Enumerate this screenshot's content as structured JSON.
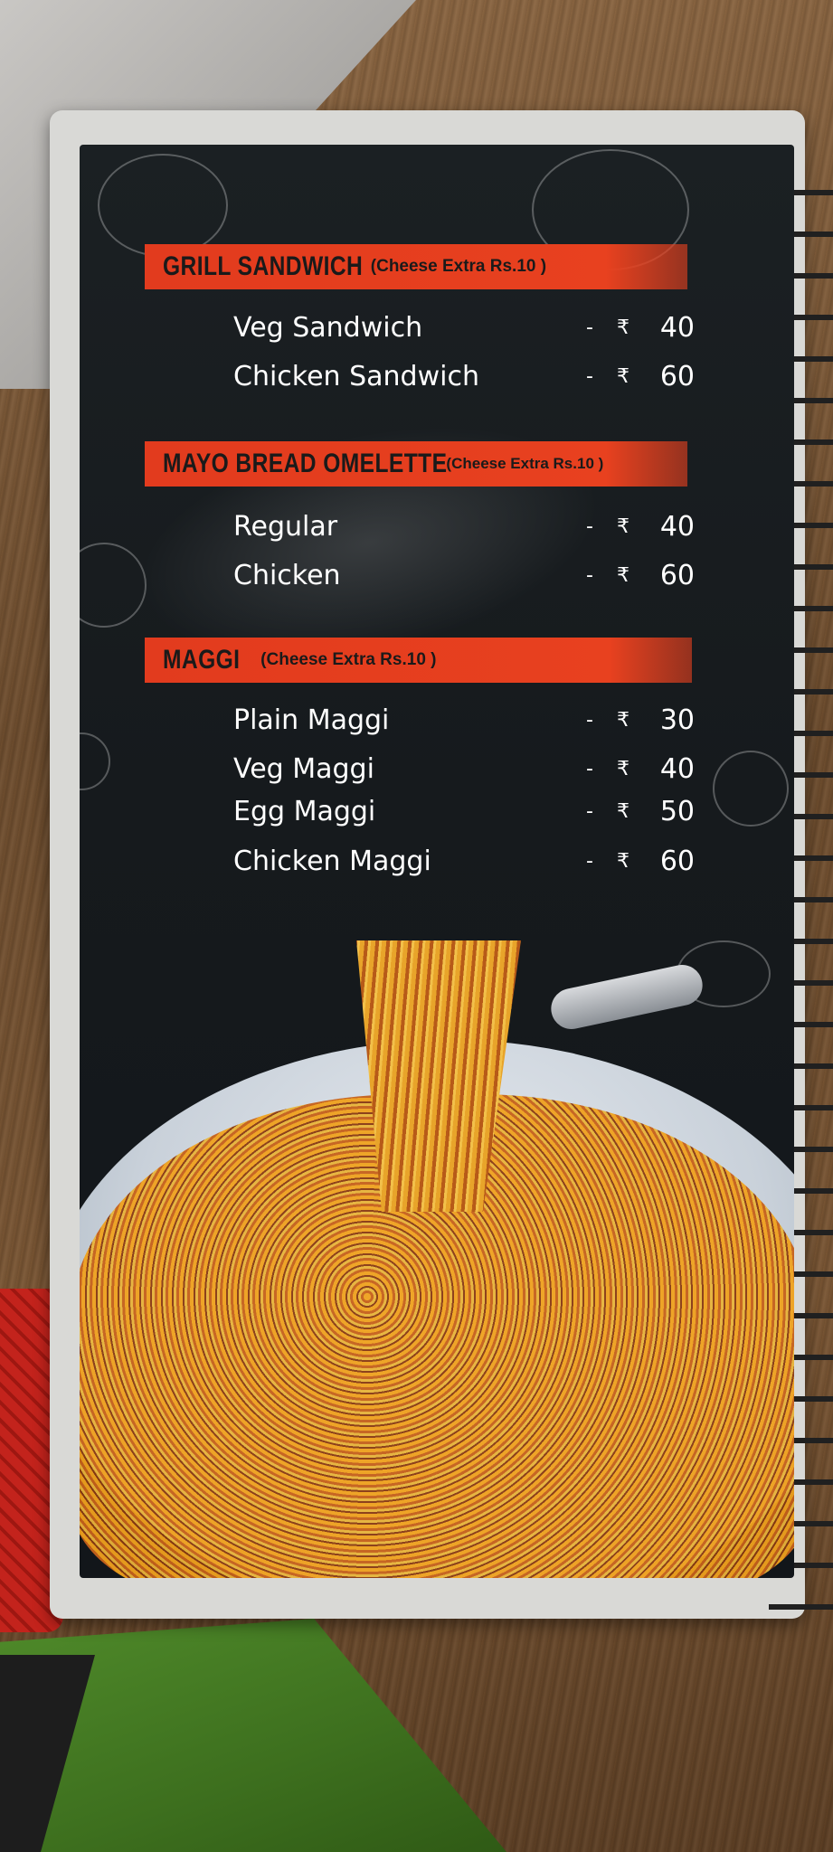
{
  "menu": {
    "sections": [
      {
        "title": "GRILL SANDWICH",
        "note": "(Cheese Extra Rs.10 )",
        "items": [
          {
            "name": "Veg Sandwich",
            "dash": "-",
            "currency": "₹",
            "price": "40"
          },
          {
            "name": "Chicken Sandwich",
            "dash": "-",
            "currency": "₹",
            "price": "60"
          }
        ]
      },
      {
        "title": "MAYO BREAD OMELETTE",
        "note": "(Cheese Extra Rs.10 )",
        "items": [
          {
            "name": "Regular",
            "dash": "-",
            "currency": "₹",
            "price": "40"
          },
          {
            "name": "Chicken",
            "dash": "-",
            "currency": "₹",
            "price": "60"
          }
        ]
      },
      {
        "title": "MAGGI",
        "note": "(Cheese Extra Rs.10 )",
        "items": [
          {
            "name": "Plain Maggi",
            "dash": "-",
            "currency": "₹",
            "price": "30"
          },
          {
            "name": "Veg Maggi",
            "dash": "-",
            "currency": "₹",
            "price": "40"
          },
          {
            "name": "Egg Maggi",
            "dash": "-",
            "currency": "₹",
            "price": "50"
          },
          {
            "name": "Chicken Maggi",
            "dash": "-",
            "currency": "₹",
            "price": "60"
          }
        ]
      }
    ]
  },
  "colors": {
    "section_bar": "#e23b1e",
    "panel_background": "#161a1d",
    "item_text": "#ffffff"
  }
}
